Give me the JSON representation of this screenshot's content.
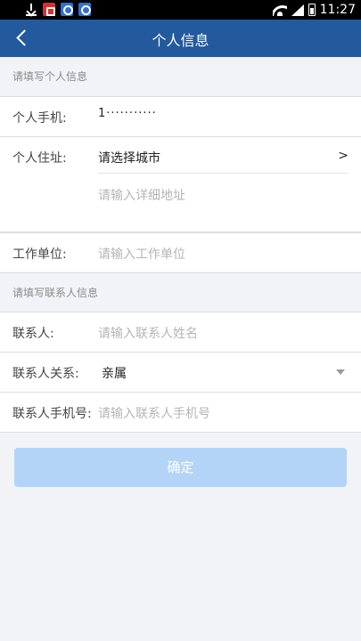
{
  "status_bar": {
    "time": "11:27",
    "icons": [
      "download-icon",
      "red-app-icon",
      "blue-app-icon",
      "blue-app-icon",
      "wifi-icon",
      "signal-icon",
      "battery-icon"
    ]
  },
  "app_bar": {
    "title": "个人信息",
    "back_icon": "back-arrow-icon",
    "color": "#23599d"
  },
  "personal_section": {
    "header": "请填写个人信息",
    "phone": {
      "label": "个人手机:",
      "value": "1···········"
    },
    "address": {
      "label": "个人住址:",
      "city_value": "请选择城市",
      "city_arrow": ">",
      "detail_placeholder": "请输入详细地址"
    },
    "work": {
      "label": "工作单位:",
      "placeholder": "请输入工作单位"
    }
  },
  "contact_section": {
    "header": "请填写联系人信息",
    "name": {
      "label": "联系人:",
      "placeholder": "请输入联系人姓名"
    },
    "relation": {
      "label": "联系人关系:",
      "value": "亲属"
    },
    "phone": {
      "label": "联系人手机号:",
      "placeholder": "请输入联系人手机号"
    }
  },
  "confirm_button": {
    "label": "确定",
    "color": "#b3d4f7"
  }
}
